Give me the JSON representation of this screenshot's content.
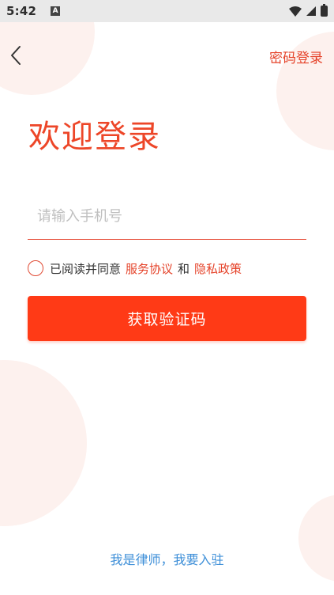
{
  "status_bar": {
    "time": "5:42",
    "badge": "A",
    "icons": [
      "wifi-icon",
      "signal-icon",
      "battery-icon"
    ]
  },
  "header": {
    "back_icon": "chevron-left-icon",
    "password_login": "密码登录"
  },
  "welcome_title": "欢迎登录",
  "phone_input": {
    "value": "",
    "placeholder": "请输入手机号"
  },
  "agreement": {
    "prefix": "已阅读并同意",
    "service_link": "服务协议",
    "conjunction": "和",
    "privacy_link": "隐私政策",
    "checked": false
  },
  "get_code_button": "获取验证码",
  "lawyer_join_link": "我是律师，我要入驻",
  "colors": {
    "accent": "#ff3a16",
    "title_red": "#ed4628",
    "link_blue": "#3e8fd8",
    "decor_circle": "#fdf1ee"
  }
}
